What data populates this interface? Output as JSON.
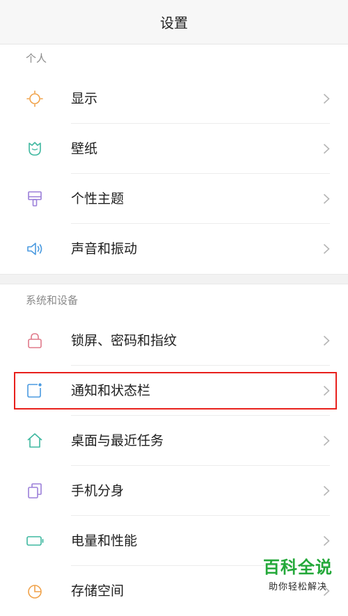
{
  "header": {
    "title": "设置"
  },
  "sections": [
    {
      "title": "个人",
      "items": [
        {
          "label": "显示",
          "icon": "sun-icon",
          "icon_color": "#f0a24a"
        },
        {
          "label": "壁纸",
          "icon": "tulip-icon",
          "icon_color": "#3fb8a0"
        },
        {
          "label": "个性主题",
          "icon": "brush-icon",
          "icon_color": "#9b7fd9"
        },
        {
          "label": "声音和振动",
          "icon": "speaker-icon",
          "icon_color": "#4a9ae0"
        }
      ]
    },
    {
      "title": "系统和设备",
      "items": [
        {
          "label": "锁屏、密码和指纹",
          "icon": "lock-icon",
          "icon_color": "#e07a8a"
        },
        {
          "label": "通知和状态栏",
          "icon": "notification-icon",
          "icon_color": "#4a9ae0"
        },
        {
          "label": "桌面与最近任务",
          "icon": "home-icon",
          "icon_color": "#3fb8a0"
        },
        {
          "label": "手机分身",
          "icon": "dual-app-icon",
          "icon_color": "#9b7fd9"
        },
        {
          "label": "电量和性能",
          "icon": "battery-icon",
          "icon_color": "#3fb8a0"
        },
        {
          "label": "存储空间",
          "icon": "storage-icon",
          "icon_color": "#f0a24a"
        }
      ]
    }
  ],
  "watermark": {
    "title": "百科全说",
    "subtitle": "助你轻松解决"
  },
  "colors": {
    "highlight": "#e8201c",
    "watermark_green": "#23a839",
    "chevron": "#b5b5b5"
  }
}
